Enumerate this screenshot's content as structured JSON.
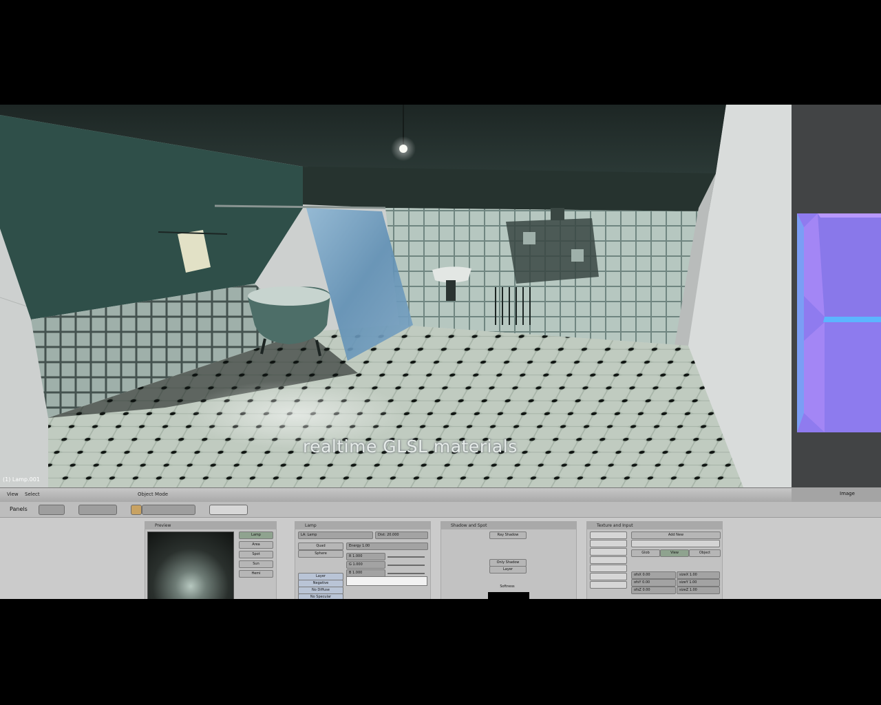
{
  "viewport": {
    "caption": "realtime GLSL materials",
    "object_label": "(1) Lamp.001"
  },
  "header": {
    "view_label": "View",
    "select_label": "Select",
    "mode_label": "Object Mode",
    "image_menu_label": "Image"
  },
  "buttons_window": {
    "panels_label": "Panels",
    "preview_panel_title": "Preview",
    "preview_buttons": [
      "Lamp",
      "Area",
      "Spot",
      "Sun",
      "Hemi"
    ],
    "lamp_panel_title": "Lamp",
    "lamp": {
      "type_button": "LA: Lamp",
      "dist_field": "Dist: 20.000",
      "mode_button_1": "Quad",
      "mode_button_2": "Sphere",
      "energy_field": "Energy 1.00",
      "r_field": "R 1.000",
      "g_field": "G 1.000",
      "b_field": "B 1.000",
      "lamp_buttons": [
        "Layer",
        "Negative",
        "No Diffuse",
        "No Specular"
      ]
    },
    "shadow_panel_title": "Shadow and Spot",
    "shadow": {
      "ray_shadow": "Ray Shadow",
      "buf_shadow_1": "Only Shadow",
      "buf_shadow_2": "Layer",
      "softness_label": "Softness"
    },
    "texture_panel_title": "Texture and Input",
    "texture": {
      "tex_slots": [
        "",
        "",
        "",
        "",
        "",
        "",
        ""
      ],
      "add_new": "Add New",
      "glob": "Glob",
      "view": "View",
      "object": "Object",
      "ofs_x": "ofsX 0.00",
      "ofs_y": "ofsY 0.00",
      "ofs_z": "ofsZ 0.00",
      "size_x": "sizeX 1.00",
      "size_y": "sizeY 1.00",
      "size_z": "sizeZ 1.00"
    }
  },
  "colors": {
    "tile_wall": "#2f4d48",
    "tile_floor": "#a8b5aa",
    "ui_grey": "#c2c2c2",
    "normal_map": "#8f7cf0"
  },
  "icons": [
    "lamp-icon",
    "camera-icon",
    "render-icon"
  ]
}
